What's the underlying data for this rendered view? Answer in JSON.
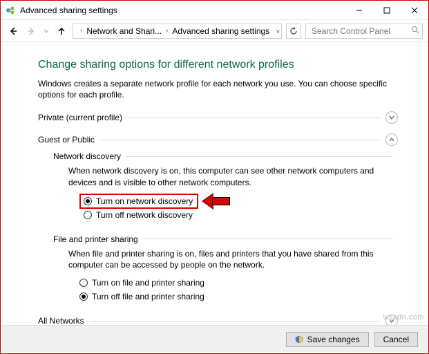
{
  "window": {
    "title": "Advanced sharing settings"
  },
  "nav": {
    "crumb1": "Network and Shari...",
    "crumb2": "Advanced sharing settings",
    "search_placeholder": "Search Control Panel"
  },
  "page": {
    "heading": "Change sharing options for different network profiles",
    "intro": "Windows creates a separate network profile for each network you use. You can choose specific options for each profile."
  },
  "sections": {
    "private_label": "Private (current profile)",
    "guest_label": "Guest or Public",
    "all_label": "All Networks"
  },
  "network_discovery": {
    "title": "Network discovery",
    "desc": "When network discovery is on, this computer can see other network computers and devices and is visible to other network computers.",
    "opt_on": "Turn on network discovery",
    "opt_off": "Turn off network discovery"
  },
  "file_sharing": {
    "title": "File and printer sharing",
    "desc": "When file and printer sharing is on, files and printers that you have shared from this computer can be accessed by people on the network.",
    "opt_on": "Turn on file and printer sharing",
    "opt_off": "Turn off file and printer sharing"
  },
  "footer": {
    "save": "Save changes",
    "cancel": "Cancel"
  },
  "watermark": "wsxdn.com"
}
